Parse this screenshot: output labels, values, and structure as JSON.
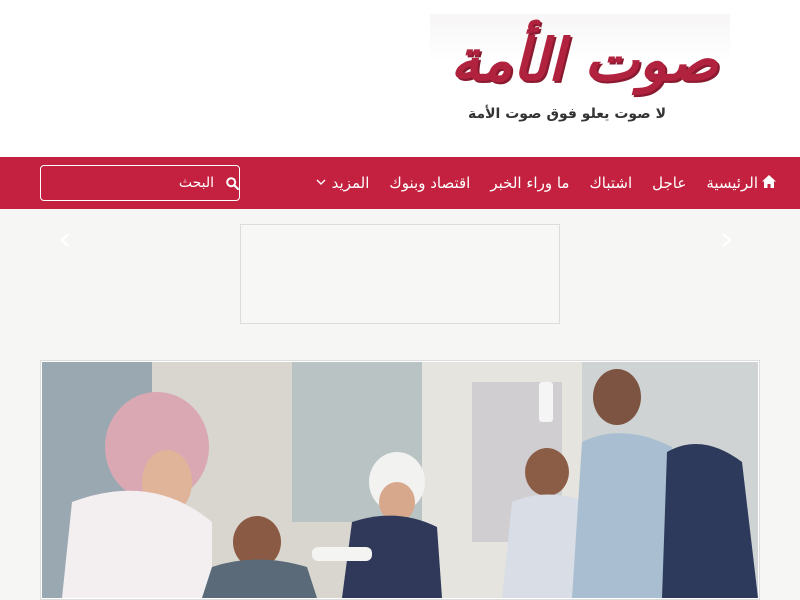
{
  "logo": {
    "mark": "صوت الأمة",
    "tagline": "لا صوت يعلو فوق صوت الأمة"
  },
  "nav": {
    "items": [
      {
        "label": "الرئيسية",
        "icon": "home-icon"
      },
      {
        "label": "عاجل"
      },
      {
        "label": "اشتباك"
      },
      {
        "label": "ما وراء الخبر"
      },
      {
        "label": "اقتصاد وبنوك"
      },
      {
        "label": "المزيد",
        "icon": "chevron-down-icon"
      }
    ]
  },
  "search": {
    "placeholder": "البحث",
    "icon": "search-icon"
  },
  "slider": {
    "prev_icon": "chevron-left-icon",
    "next_icon": "chevron-right-icon",
    "slide_image": "vaccination-photo"
  },
  "colors": {
    "brand": "#c3213f",
    "nav_text": "#ffffff",
    "page_bg": "#f6f6f4"
  }
}
